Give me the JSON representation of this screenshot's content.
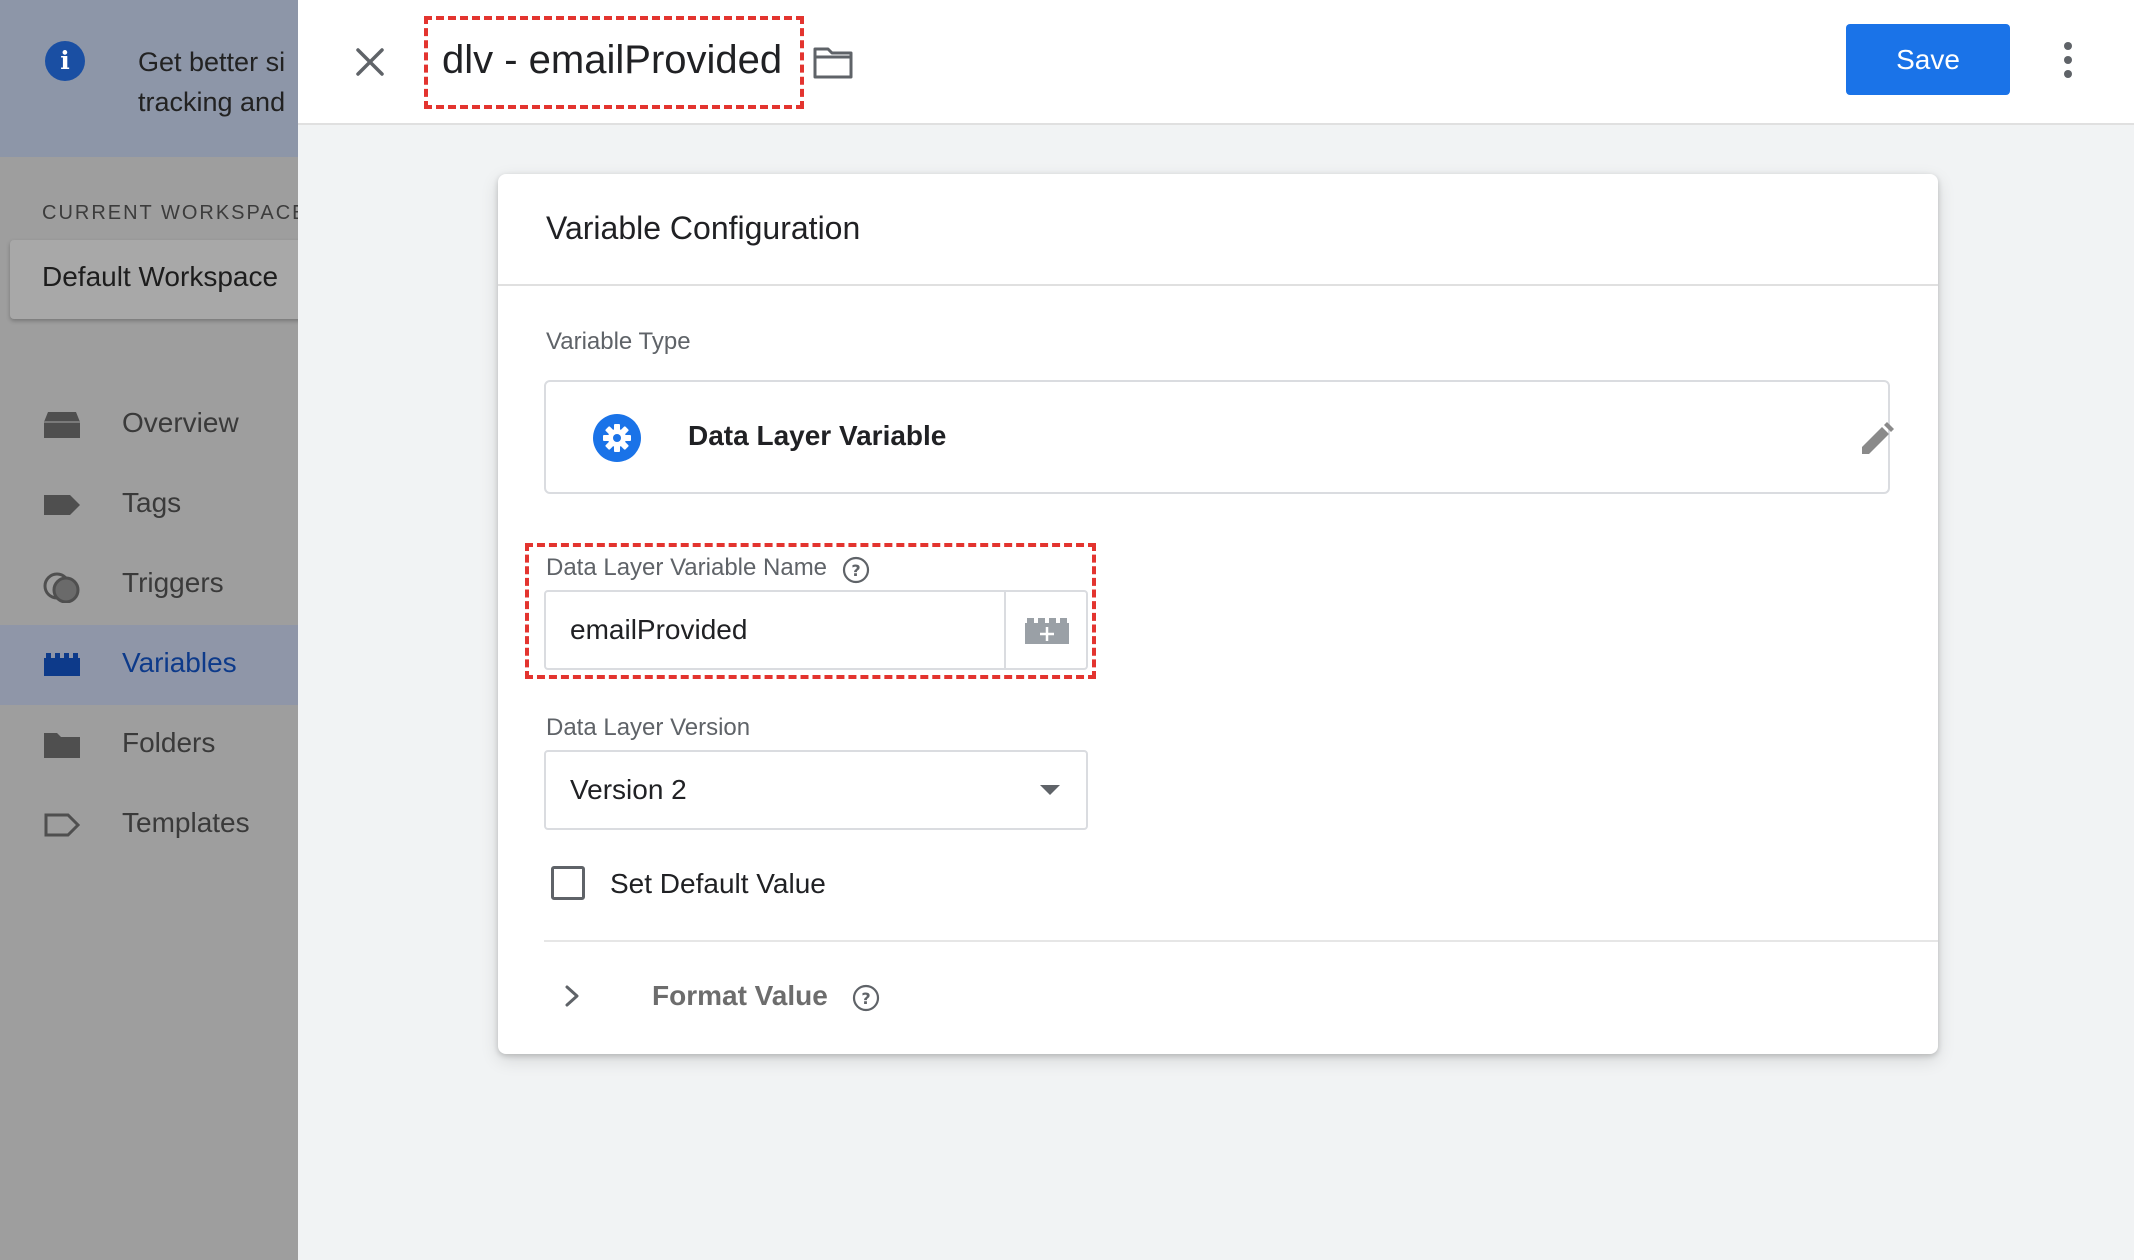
{
  "sidebar": {
    "banner_line1": "Get better si",
    "banner_line2": "tracking and",
    "workspace_label": "CURRENT WORKSPACE",
    "workspace_name": "Default Workspace",
    "items": [
      {
        "label": "Overview",
        "icon": "overview-icon"
      },
      {
        "label": "Tags",
        "icon": "tag-icon"
      },
      {
        "label": "Triggers",
        "icon": "trigger-icon"
      },
      {
        "label": "Variables",
        "icon": "variables-icon",
        "active": true
      },
      {
        "label": "Folders",
        "icon": "folder-icon"
      },
      {
        "label": "Templates",
        "icon": "template-icon"
      }
    ]
  },
  "header": {
    "title": "dlv - emailProvided",
    "save_label": "Save"
  },
  "card": {
    "title": "Variable Configuration",
    "variable_type_label": "Variable Type",
    "variable_type_name": "Data Layer Variable",
    "dlv_name_label": "Data Layer Variable Name",
    "dlv_name_value": "emailProvided",
    "dlv_version_label": "Data Layer Version",
    "dlv_version_value": "Version 2",
    "default_value_label": "Set Default Value",
    "default_value_checked": false,
    "format_value_label": "Format Value"
  },
  "colors": {
    "accent": "#1a73e8",
    "highlight": "#e3342f",
    "active_nav": "#0d3a8a"
  }
}
